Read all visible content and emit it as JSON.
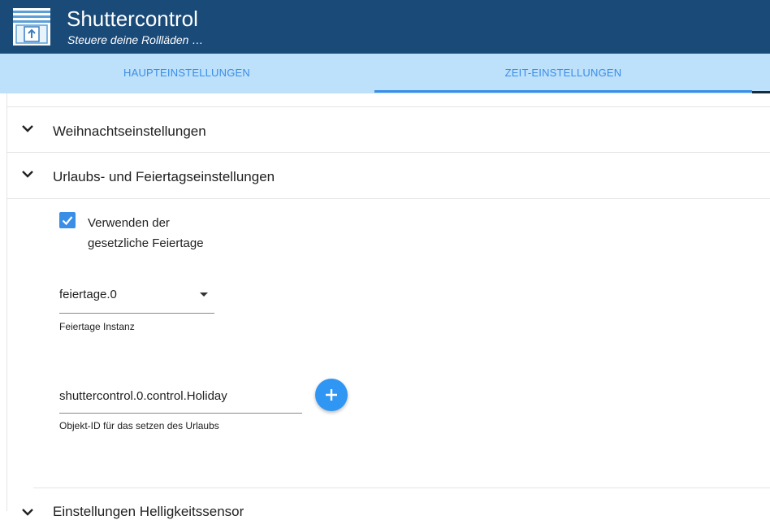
{
  "header": {
    "title": "Shuttercontrol",
    "subtitle": "Steuere deine Rollläden …",
    "logo_icon": "shutter-logo-icon"
  },
  "tabs": [
    {
      "label": "HAUPTEINSTELLUNGEN",
      "active": false
    },
    {
      "label": "ZEIT-EINSTELLUNGEN",
      "active": true
    }
  ],
  "sections": {
    "christmas": {
      "label": "Weihnachtseinstellungen",
      "expanded": false
    },
    "holiday": {
      "label": "Urlaubs- und Feiertagseinstellungen",
      "expanded": true
    },
    "brightness": {
      "label": "Einstellungen Helligkeitssensor",
      "expanded": false
    }
  },
  "holiday_settings": {
    "use_holidays": {
      "label": "Verwenden der gesetzliche Feiertage",
      "checked": true
    },
    "instance_select": {
      "value": "feiertage.0",
      "helper": "Feiertage Instanz"
    },
    "object_id_input": {
      "value": "shuttercontrol.0.control.Holiday",
      "helper": "Objekt-ID für das setzen des Urlaubs"
    },
    "add_button_icon": "plus-icon"
  },
  "colors": {
    "header_bg": "#1a4a78",
    "tab_bar_bg": "#bde0fb",
    "accent": "#3a8ee6",
    "fab": "#2f96f3"
  }
}
